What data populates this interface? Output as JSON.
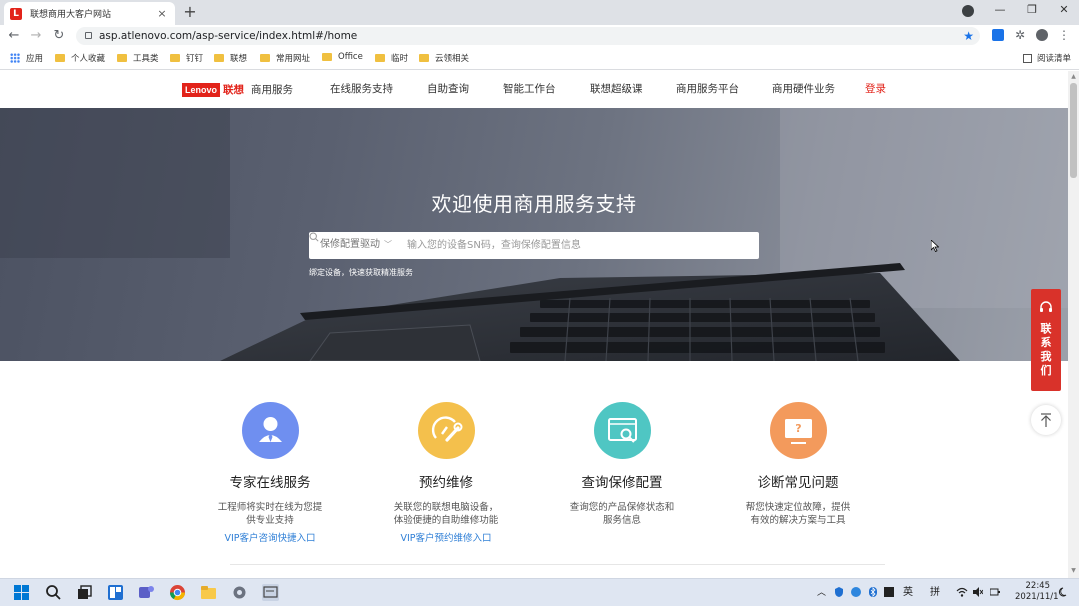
{
  "browser": {
    "tab_title": "联想商用大客户网站",
    "tab_close": "×",
    "new_tab": "+",
    "url": "asp.atlenovo.com/asp-service/index.html#/home",
    "nav": {
      "back": "←",
      "forward": "→",
      "reload": "↻"
    },
    "win": {
      "minimize": "—",
      "maximize": "❐",
      "close": "✕"
    }
  },
  "bookmarks": {
    "items": [
      {
        "label": "应用",
        "icon": "apps-icon"
      },
      {
        "label": "个人收藏",
        "icon": "folder-icon"
      },
      {
        "label": "工具类",
        "icon": "folder-icon"
      },
      {
        "label": "钉钉",
        "icon": "folder-icon"
      },
      {
        "label": "联想",
        "icon": "folder-icon"
      },
      {
        "label": "常用网址",
        "icon": "folder-icon"
      },
      {
        "label": "Office",
        "icon": "folder-icon"
      },
      {
        "label": "临时",
        "icon": "folder-icon"
      },
      {
        "label": "云领相关",
        "icon": "folder-icon"
      }
    ],
    "reading_list": "阅读清单"
  },
  "header": {
    "logo_en": "Lenovo",
    "logo_cn": "联想",
    "brand_sub": "商用服务",
    "nav": [
      "在线服务支持",
      "自助查询",
      "智能工作台",
      "联想超级课",
      "商用服务平台",
      "商用硬件业务"
    ],
    "login": "登录"
  },
  "hero": {
    "title": "欢迎使用商用服务支持",
    "search_select": "保修配置驱动",
    "search_placeholder": "输入您的设备SN码，查询保修配置信息",
    "bind_hint": "绑定设备，快速获取精准服务"
  },
  "contact": {
    "label": [
      "联",
      "系",
      "我",
      "们"
    ]
  },
  "services": [
    {
      "title": "专家在线服务",
      "desc": [
        "工程师将实时在线为您提",
        "供专业支持"
      ],
      "link": "VIP客户咨询快捷入口",
      "color": "#6f8ff0"
    },
    {
      "title": "预约维修",
      "desc": [
        "关联您的联想电脑设备，",
        "体验便捷的自助维修功能"
      ],
      "link": "VIP客户预约维修入口",
      "color": "#f4c04c"
    },
    {
      "title": "查询保修配置",
      "desc": [
        "查询您的产品保修状态和",
        "服务信息"
      ],
      "link": "",
      "color": "#4fc6c3"
    },
    {
      "title": "诊断常见问题",
      "desc": [
        "帮您快速定位故障，提供",
        "有效的解决方案与工具"
      ],
      "link": "",
      "color": "#f39a5c"
    }
  ],
  "taskbar": {
    "tray": {
      "lang": "英",
      "ime": "拼",
      "time": "22:45",
      "date": "2021/11/1"
    }
  },
  "colors": {
    "brand_red": "#e2231a",
    "link_blue": "#2f7fd6",
    "contact_red": "#d9322a"
  }
}
